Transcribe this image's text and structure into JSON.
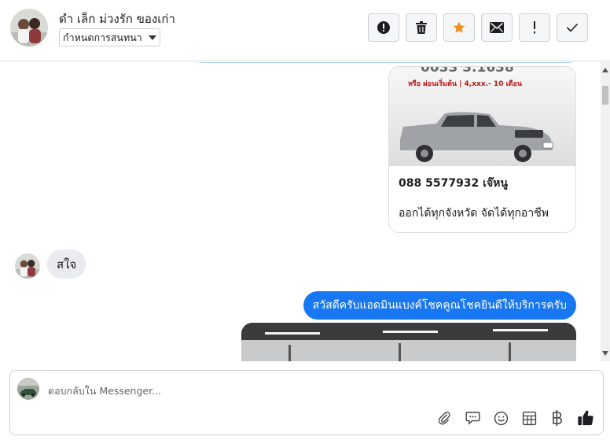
{
  "header": {
    "contact_name": "ดำ เล็ก ม่วงรัก ของเก่า",
    "assign_label": "กำหนดการสนทนา"
  },
  "toolbar": {
    "spam_icon": "exclamation-circle-icon",
    "delete_icon": "trash-icon",
    "star_icon": "star-icon",
    "mail_icon": "envelope-icon",
    "follow_up_icon": "exclamation-icon",
    "done_icon": "checkmark-icon",
    "star_color": "#f08c1f"
  },
  "messages": {
    "card": {
      "banner_text": "หรือ ผ่อนเริ่มต้น | 4,xxx.- 10 เดือน",
      "phone": "088 5577932 เจ๊หนู",
      "description": "ออกได้ทุกจังหวัด จัดได้ทุกอาชีพ"
    },
    "incoming_text": "สใจ",
    "outgoing_text": "สวัสดีครับแอดมินแบงค์โชคคูณโชคยินดีให้บริการครับ"
  },
  "composer": {
    "placeholder": "ตอบกลับใน Messenger...",
    "icons": [
      "paperclip-icon",
      "chat-bubble-icon",
      "smiley-icon",
      "table-icon",
      "baht-icon",
      "thumbs-up-icon"
    ]
  },
  "colors": {
    "accent": "#1877f2",
    "incoming_bubble": "#e9ebee"
  }
}
